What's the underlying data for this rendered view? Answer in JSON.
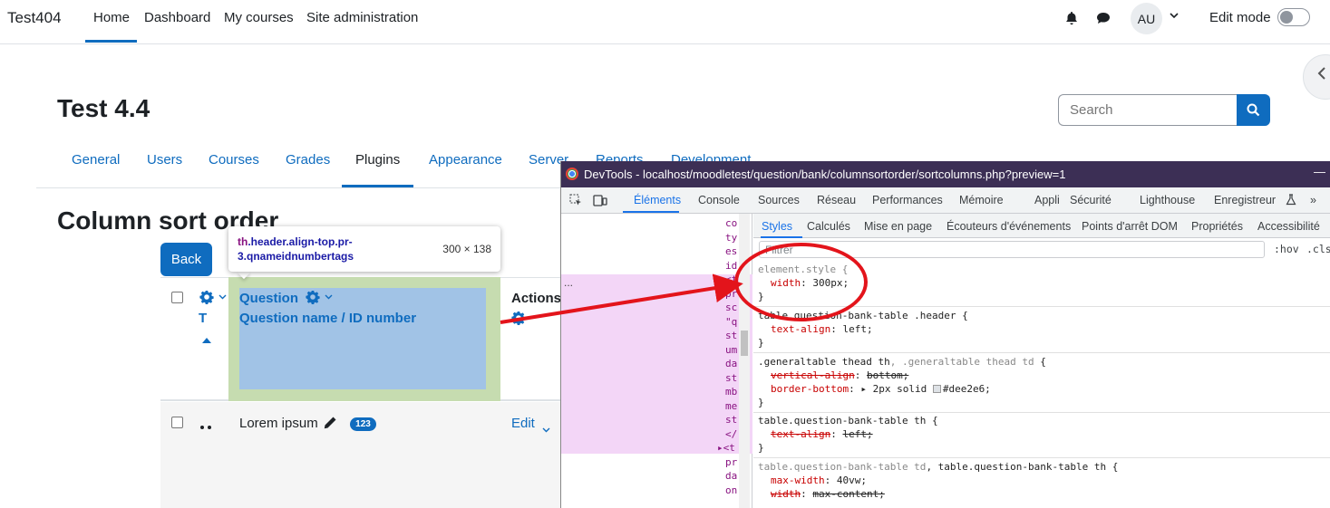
{
  "navbar": {
    "brand": "Test404",
    "items": [
      "Home",
      "Dashboard",
      "My courses",
      "Site administration"
    ],
    "avatar": "AU",
    "edit_mode_label": "Edit mode"
  },
  "page": {
    "title": "Test 4.4",
    "search_placeholder": "Search",
    "tabs": [
      "General",
      "Users",
      "Courses",
      "Grades",
      "Plugins",
      "Appearance",
      "Server",
      "Reports",
      "Development"
    ],
    "section_title": "Column sort order",
    "back_label": "Back"
  },
  "table": {
    "col_t": "T",
    "question_header": "Question",
    "question_sub": "Question name / ID number",
    "actions_header": "Actions",
    "row_name": "Lorem ipsum",
    "row_badge": "123",
    "row_edit": "Edit"
  },
  "tooltip": {
    "tag": "th",
    "selector": ".header.align-top.pr-3.qnameidnumbertags",
    "dimensions": "300 × 138"
  },
  "devtools": {
    "title": "DevTools - localhost/moodletest/question/bank/columnsortorder/sortcolumns.php?preview=1",
    "panels": [
      "Éléments",
      "Console",
      "Sources",
      "Réseau",
      "Performances",
      "Mémoire",
      "Appli",
      "Sécurité",
      "Lighthouse",
      "Enregistreur",
      "»"
    ],
    "subtabs": [
      "Styles",
      "Calculés",
      "Mise en page",
      "Écouteurs d'événements",
      "Points d'arrêt DOM",
      "Propriétés",
      "Accessibilité"
    ],
    "filter_placeholder": "Filtrer",
    "hov": ":hov",
    "cls": ".cls",
    "elements_fragments": [
      "co",
      "ty",
      "es",
      "id",
      "<t",
      "pr",
      "sc",
      "\"q",
      "st",
      "um",
      "da",
      "st",
      "mb",
      "me",
      "st",
      "</",
      "▸<t",
      "pr",
      "da",
      "on"
    ],
    "ellipsis": "...",
    "rules": [
      {
        "selector": "element.style {",
        "decls": [
          {
            "prop": "width",
            "val": "300px;"
          }
        ],
        "close": "}"
      },
      {
        "selector": "table.question-bank-table .header {",
        "decls": [
          {
            "prop": "text-align",
            "val": "left;"
          }
        ],
        "close": "}"
      },
      {
        "selector_dim": ".generaltable thead th, .generaltable thead td {",
        "decls": [
          {
            "prop": "vertical-align",
            "val": "bottom;",
            "struck": true
          },
          {
            "prop": "border-bottom",
            "val": "▸ 2px solid ■#dee2e6;"
          }
        ],
        "close": "}"
      },
      {
        "selector": "table.question-bank-table th {",
        "decls": [
          {
            "prop": "text-align",
            "val": "left;",
            "struck": true
          }
        ],
        "close": "}"
      },
      {
        "selector_dim": "table.question-bank-table td, table.question-bank-table th {",
        "decls": [
          {
            "prop": "max-width",
            "val": "40vw;"
          },
          {
            "prop": "width",
            "val": "max-content;",
            "struck": true
          }
        ],
        "close": "}"
      }
    ]
  },
  "colors": {
    "primary": "#0f6cbf",
    "highlight_padding": "#c6dcb0",
    "highlight_content": "#a1c3e6",
    "annotation_red": "#e3141b",
    "devtools_title_bg": "#3c2f55"
  }
}
